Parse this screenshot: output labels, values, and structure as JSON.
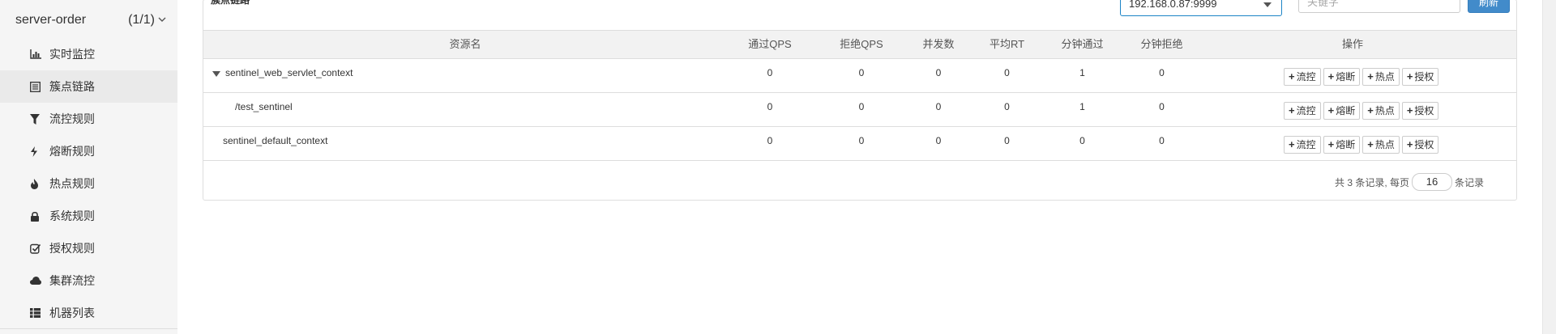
{
  "sidebar": {
    "app_name": "server-order",
    "app_count": "(1/1)",
    "items": [
      {
        "label": "实时监控",
        "icon": "bar-chart-icon"
      },
      {
        "label": "簇点链路",
        "icon": "list-icon"
      },
      {
        "label": "流控规则",
        "icon": "filter-icon"
      },
      {
        "label": "熔断规则",
        "icon": "bolt-icon"
      },
      {
        "label": "热点规则",
        "icon": "fire-icon"
      },
      {
        "label": "系统规则",
        "icon": "lock-icon"
      },
      {
        "label": "授权规则",
        "icon": "check-square-icon"
      },
      {
        "label": "集群流控",
        "icon": "cloud-icon"
      },
      {
        "label": "机器列表",
        "icon": "th-list-icon"
      }
    ],
    "active_item": "簇点链路"
  },
  "toolbar": {
    "title": "簇点链路",
    "machine_select_value": "192.168.0.87:9999",
    "keyword_placeholder": "关键字",
    "refresh_label": "刷新"
  },
  "table": {
    "headers": [
      "资源名",
      "通过QPS",
      "拒绝QPS",
      "并发数",
      "平均RT",
      "分钟通过",
      "分钟拒绝",
      "操作"
    ],
    "rows": [
      {
        "name": "sentinel_web_servlet_context",
        "expanded": true,
        "level": 0,
        "pass_qps": "0",
        "block_qps": "0",
        "threads": "0",
        "avg_rt": "0",
        "minute_pass": "1",
        "minute_block": "0"
      },
      {
        "name": "/test_sentinel",
        "level": 1,
        "pass_qps": "0",
        "block_qps": "0",
        "threads": "0",
        "avg_rt": "0",
        "minute_pass": "1",
        "minute_block": "0"
      },
      {
        "name": "sentinel_default_context",
        "level": 0,
        "pass_qps": "0",
        "block_qps": "0",
        "threads": "0",
        "avg_rt": "0",
        "minute_pass": "0",
        "minute_block": "0"
      }
    ],
    "actions": [
      "流控",
      "熔断",
      "热点",
      "授权"
    ]
  },
  "pagination": {
    "prefix": "共 3 条记录, 每页",
    "page_size": "16",
    "suffix": "条记录"
  }
}
